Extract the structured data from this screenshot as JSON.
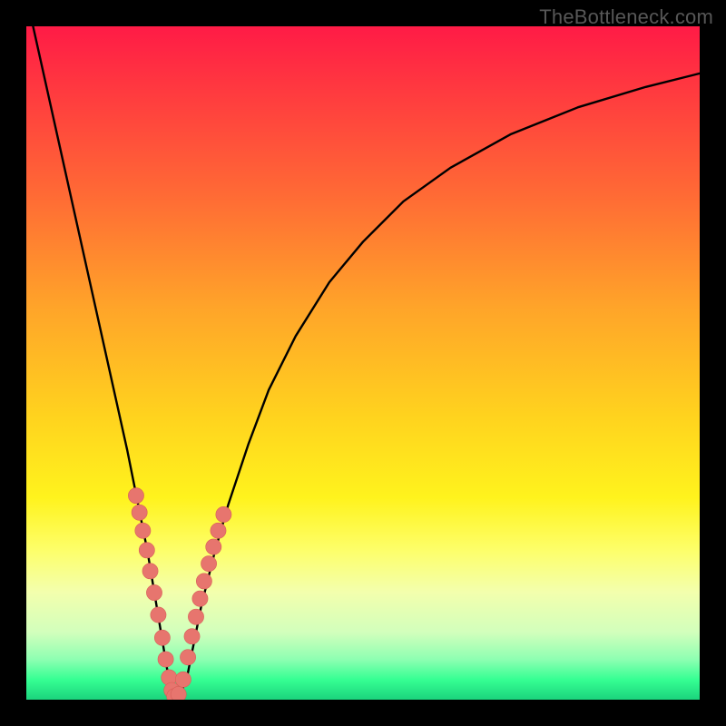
{
  "watermark": "TheBottleneck.com",
  "colors": {
    "frame": "#000000",
    "curve": "#000000",
    "dot": "#e7756e",
    "dot_stroke": "#d85f58"
  },
  "chart_data": {
    "type": "line",
    "title": "",
    "xlabel": "",
    "ylabel": "",
    "xlim": [
      0,
      100
    ],
    "ylim": [
      0,
      100
    ],
    "grid": false,
    "legend": false,
    "series": [
      {
        "name": "bottleneck-curve",
        "x": [
          1,
          3,
          5,
          7,
          9,
          11,
          13,
          15,
          17,
          18,
          19,
          20,
          21,
          22,
          23,
          24,
          25,
          26,
          28,
          30,
          33,
          36,
          40,
          45,
          50,
          56,
          63,
          72,
          82,
          92,
          100
        ],
        "y": [
          100,
          91,
          82,
          73,
          64,
          55,
          46,
          37,
          27,
          22,
          16,
          10,
          4,
          1,
          1,
          4,
          9,
          14,
          22,
          29,
          38,
          46,
          54,
          62,
          68,
          74,
          79,
          84,
          88,
          91,
          93
        ]
      }
    ],
    "dots": {
      "name": "sample-points",
      "x": [
        16.3,
        16.8,
        17.3,
        17.9,
        18.4,
        19.0,
        19.6,
        20.2,
        20.7,
        21.2,
        21.6,
        22.0,
        22.6,
        23.3,
        24.0,
        24.6,
        25.2,
        25.8,
        26.4,
        27.1,
        27.8,
        28.5,
        29.3
      ],
      "y": [
        30.3,
        27.8,
        25.1,
        22.2,
        19.1,
        15.9,
        12.6,
        9.2,
        6.0,
        3.3,
        1.4,
        0.5,
        0.8,
        3.0,
        6.3,
        9.4,
        12.3,
        15.0,
        17.6,
        20.2,
        22.7,
        25.1,
        27.5
      ]
    }
  }
}
